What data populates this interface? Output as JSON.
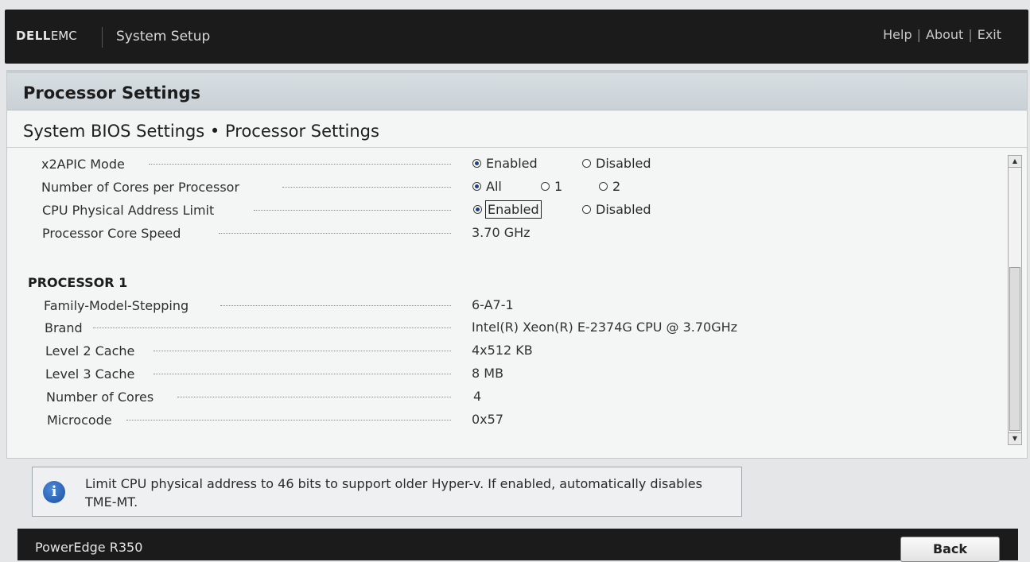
{
  "header": {
    "brand_dell": "DELL",
    "brand_emc": "EMC",
    "app_title": "System Setup",
    "links": {
      "help": "Help",
      "about": "About",
      "exit": "Exit",
      "separator": "|"
    }
  },
  "panel": {
    "title": "Processor Settings",
    "breadcrumb": "System BIOS Settings • Processor Settings"
  },
  "settings": {
    "x2apic": {
      "label": "x2APIC Mode",
      "opt_enabled": "Enabled",
      "opt_disabled": "Disabled",
      "selected": "Enabled"
    },
    "cores_per_proc": {
      "label": "Number of Cores per Processor",
      "opt_all": "All",
      "opt_1": "1",
      "opt_2": "2",
      "selected": "All"
    },
    "phys_addr_limit": {
      "label": "CPU Physical Address Limit",
      "opt_enabled": "Enabled",
      "opt_disabled": "Disabled",
      "selected": "Enabled"
    },
    "core_speed": {
      "label": "Processor Core Speed",
      "value": "3.70 GHz"
    }
  },
  "processor1": {
    "heading": "PROCESSOR 1",
    "family": {
      "label": "Family-Model-Stepping",
      "value": "6-A7-1"
    },
    "brand": {
      "label": "Brand",
      "value": "Intel(R) Xeon(R) E-2374G CPU @ 3.70GHz"
    },
    "l2": {
      "label": "Level 2 Cache",
      "value": "4x512 KB"
    },
    "l3": {
      "label": "Level 3 Cache",
      "value": "8 MB"
    },
    "cores": {
      "label": "Number of Cores",
      "value": "4"
    },
    "microcode": {
      "label": "Microcode",
      "value": "0x57"
    }
  },
  "help_text": "Limit CPU physical address to 46 bits to support older Hyper-v. If enabled, automatically disables TME-MT.",
  "footer": {
    "model": "PowerEdge R350",
    "back_label": "Back"
  },
  "icons": {
    "info": "info-icon",
    "scroll_up": "arrow-up-icon",
    "scroll_down": "arrow-down-icon"
  }
}
